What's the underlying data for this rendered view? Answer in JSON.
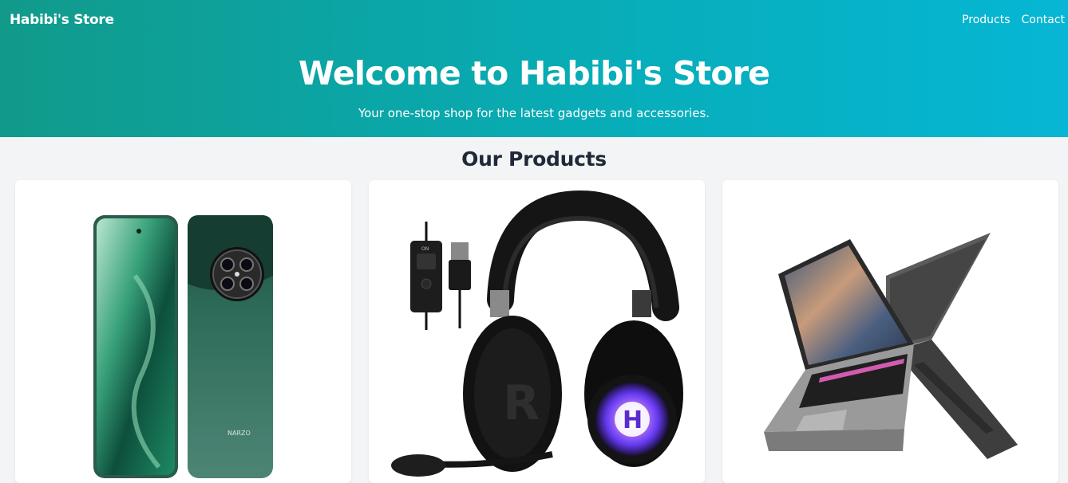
{
  "header": {
    "brand": "Habibi's Store",
    "nav": [
      "Products",
      "Contact"
    ]
  },
  "hero": {
    "title": "Welcome to Habibi's Store",
    "subtitle": "Your one-stop shop for the latest gadgets and accessories."
  },
  "products_section": {
    "title": "Our Products",
    "products": [
      {
        "image": "smartphone-image",
        "phone_text": "NARZO"
      },
      {
        "image": "gaming-headset-image",
        "control_labels": [
          "ON"
        ]
      },
      {
        "image": "laptop-case-image"
      }
    ]
  }
}
